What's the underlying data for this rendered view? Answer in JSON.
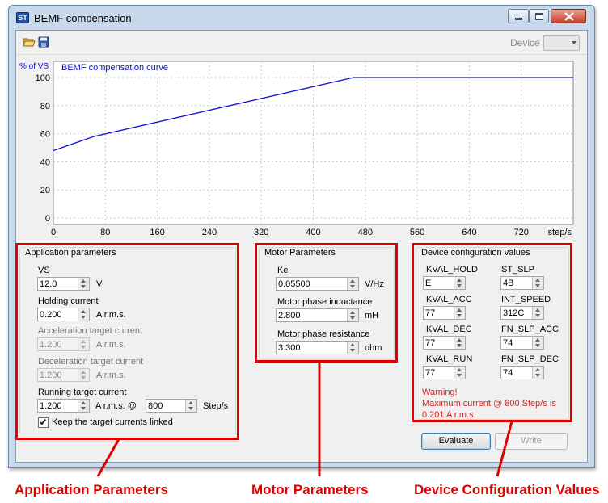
{
  "window": {
    "title": "BEMF compensation"
  },
  "toolbar": {
    "device_label": "Device",
    "device_value": ""
  },
  "chart_data": {
    "type": "line",
    "title": "BEMF compensation curve",
    "ylabel": "% of VS",
    "xlabel": "step/s",
    "xlim": [
      0,
      800
    ],
    "ylim": [
      0,
      100
    ],
    "xticks": [
      0,
      80,
      160,
      240,
      320,
      400,
      480,
      560,
      640,
      720
    ],
    "yticks": [
      0,
      20,
      40,
      60,
      80,
      100
    ],
    "grid": true,
    "line_color": "#1010d0",
    "series": [
      {
        "x": [
          0,
          62,
          462,
          800
        ],
        "y": [
          48,
          58,
          100,
          100
        ]
      }
    ]
  },
  "app_params": {
    "title": "Application parameters",
    "vs_label": "VS",
    "vs_value": "12.0",
    "vs_unit": "V",
    "holding_label": "Holding current",
    "holding_value": "0.200",
    "holding_unit": "A r.m.s.",
    "acc_label": "Acceleration target current",
    "acc_value": "1.200",
    "acc_unit": "A r.m.s.",
    "dec_label": "Deceleration target current",
    "dec_value": "1.200",
    "dec_unit": "A r.m.s.",
    "run_label": "Running target current",
    "run_value": "1.200",
    "run_unit": "A r.m.s. @",
    "speed_value": "800",
    "speed_unit": "Step/s",
    "linked_label": "Keep the target currents linked",
    "linked_checked": true
  },
  "motor_params": {
    "title": "Motor Parameters",
    "ke_label": "Ke",
    "ke_value": "0.05500",
    "ke_unit": "V/Hz",
    "ind_label": "Motor phase inductance",
    "ind_value": "2.800",
    "ind_unit": "mH",
    "res_label": "Motor phase resistance",
    "res_value": "3.300",
    "res_unit": "ohm"
  },
  "device_cfg": {
    "title": "Device configuration values",
    "kval_hold_label": "KVAL_HOLD",
    "kval_hold_value": "E",
    "kval_acc_label": "KVAL_ACC",
    "kval_acc_value": "77",
    "kval_dec_label": "KVAL_DEC",
    "kval_dec_value": "77",
    "kval_run_label": "KVAL_RUN",
    "kval_run_value": "77",
    "st_slp_label": "ST_SLP",
    "st_slp_value": "4B",
    "int_speed_label": "INT_SPEED",
    "int_speed_value": "312C",
    "fn_slp_acc_label": "FN_SLP_ACC",
    "fn_slp_acc_value": "74",
    "fn_slp_dec_label": "FN_SLP_DEC",
    "fn_slp_dec_value": "74",
    "warning_title": "Warning!",
    "warning_line1": "Maximum current @ 800 Step/s is",
    "warning_line2": "0.201 A r.m.s."
  },
  "actions": {
    "evaluate_label": "Evaluate",
    "write_label": "Write"
  },
  "annotations": {
    "app": "Application Parameters",
    "motor": "Motor Parameters",
    "device": "Device Configuration Values",
    "color": "#e00000"
  }
}
